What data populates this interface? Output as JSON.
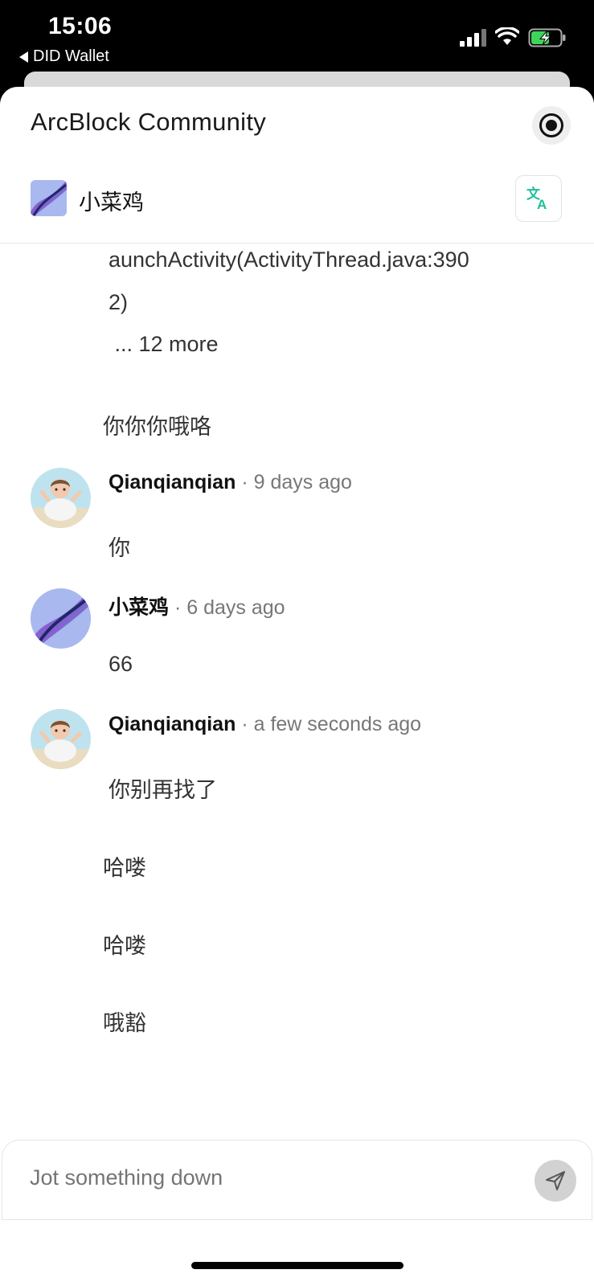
{
  "status_bar": {
    "time": "15:06",
    "back_app_label": "DID Wallet",
    "icons": [
      "signal-icon",
      "wifi-icon",
      "battery-charging-icon"
    ]
  },
  "header": {
    "title": "ArcBlock Community",
    "record_icon": "record-icon"
  },
  "thread_user": {
    "name": "小菜鸡",
    "translate_icon": "translate-icon"
  },
  "messages": {
    "first_tail": {
      "lines": [
        "aunchActivity(ActivityThread.java:390",
        "2)",
        " ... 12 more"
      ],
      "followup": "你你你哦咯"
    },
    "m1": {
      "author": "Qianqianqian",
      "ago": "9 days ago",
      "text": "你"
    },
    "m2": {
      "author": "小菜鸡",
      "ago": "6 days ago",
      "text": "66"
    },
    "m3": {
      "author": "Qianqianqian",
      "ago": "a few seconds ago",
      "text": "你别再找了",
      "followups": [
        "哈喽",
        "哈喽",
        "哦豁"
      ]
    },
    "separator": "·"
  },
  "composer": {
    "placeholder": "Jot something down",
    "send_icon": "send-icon"
  },
  "colors": {
    "background": "#ffffff",
    "status_bar": "#000000",
    "translate_accent": "#1fbf9a",
    "muted_text": "#777777"
  }
}
